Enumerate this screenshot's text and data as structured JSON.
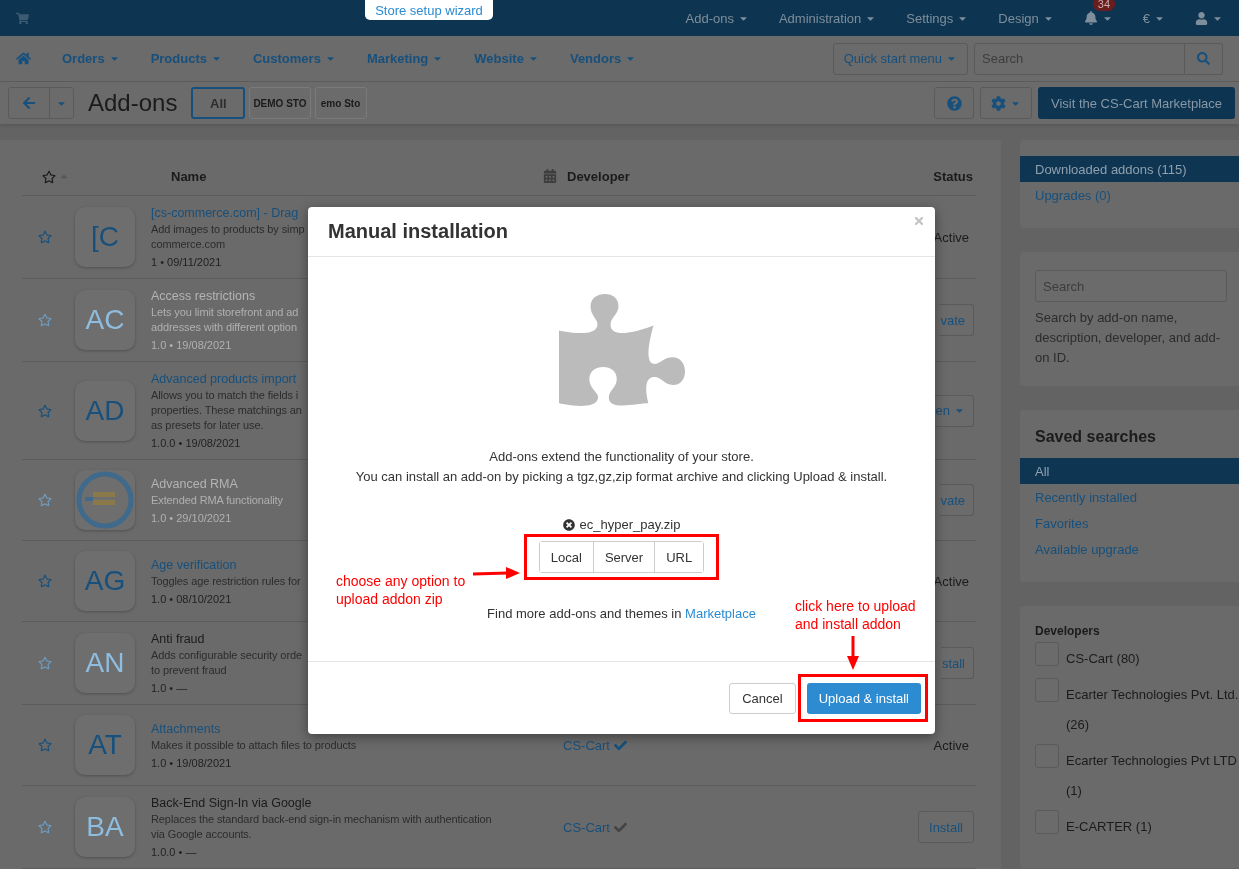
{
  "top_bar": {
    "wizard_tab": "Store setup wizard",
    "menus": [
      "Add-ons",
      "Administration",
      "Settings",
      "Design"
    ],
    "notifications": {
      "count": "34"
    },
    "currency": "€"
  },
  "nav_bar": {
    "menus": [
      "Orders",
      "Products",
      "Customers",
      "Marketing",
      "Website",
      "Vendors"
    ],
    "quick_start": "Quick start menu",
    "search": {
      "placeholder": "Search"
    }
  },
  "toolbar": {
    "title": "Add-ons",
    "storefront_tabs": [
      {
        "label": "All",
        "selected": true,
        "kind": "text"
      },
      {
        "label": "DEMO STO",
        "selected": false,
        "kind": "logo"
      },
      {
        "label": "emo Sto",
        "selected": false,
        "kind": "logo"
      }
    ],
    "marketplace_button": "Visit the CS-Cart Marketplace"
  },
  "table": {
    "columns": [
      "Name",
      "Developer",
      "Status"
    ],
    "rows": [
      {
        "kind": "active",
        "icon": {
          "kind": "letters",
          "text": "[C"
        },
        "title": "[cs-commerce.com] - Drag",
        "description": [
          "Add images to products by simp",
          "commerce.com"
        ],
        "meta": "1 • 09/11/2021",
        "status": {
          "kind": "text",
          "text": "Active"
        }
      },
      {
        "kind": "disabled",
        "icon": {
          "kind": "letters",
          "text": "AC"
        },
        "title": "Access restrictions",
        "description": [
          "Lets you limit storefront and ad",
          "addresses with different option"
        ],
        "meta": "1.0 • 19/08/2021",
        "status": {
          "kind": "button",
          "text": "vate"
        }
      },
      {
        "kind": "active",
        "icon": {
          "kind": "letters",
          "text": "AD"
        },
        "title": "Advanced products import",
        "description": [
          "Allows you to match the fields i",
          "properties. These matchings an",
          "as presets for later use."
        ],
        "meta": "1.0.0 • 19/08/2021",
        "status": {
          "kind": "dropdown",
          "text": "en"
        }
      },
      {
        "kind": "disabled",
        "icon": {
          "kind": "logo"
        },
        "title": "Advanced RMA",
        "description": [
          "Extended RMA functionality"
        ],
        "meta": "1.0 • 29/10/2021",
        "status": {
          "kind": "button",
          "text": "vate"
        }
      },
      {
        "kind": "active",
        "icon": {
          "kind": "letters",
          "text": "AG"
        },
        "title": "Age verification",
        "description": [
          "Toggles age restriction rules for"
        ],
        "meta": "1.0 • 08/10/2021",
        "status": {
          "kind": "text",
          "text": "Active"
        }
      },
      {
        "kind": "not_installed",
        "icon": {
          "kind": "letters",
          "text": "AN"
        },
        "title": "Anti fraud",
        "description": [
          "Adds configurable security orde",
          "to prevent fraud"
        ],
        "meta": "1.0 • —",
        "status": {
          "kind": "button",
          "text": "stall"
        }
      },
      {
        "kind": "active",
        "icon": {
          "kind": "letters",
          "text": "AT"
        },
        "title": "Attachments",
        "description": [
          "Makes it possible to attach files to products"
        ],
        "meta": "1.0 • 19/08/2021",
        "developer": {
          "name": "CS-Cart",
          "verified": true
        },
        "status": {
          "kind": "text",
          "text": "Active"
        }
      },
      {
        "kind": "not_installed",
        "icon": {
          "kind": "letters",
          "text": "BA"
        },
        "title": "Back-End Sign-In via Google",
        "description": [
          "Replaces the standard back-end sign-in mechanism with authentication",
          "via Google accounts."
        ],
        "meta": "1.0.0 • —",
        "developer": {
          "name": "CS-Cart",
          "verified": false
        },
        "status": {
          "kind": "full_button",
          "text": "Install"
        }
      }
    ]
  },
  "sidebar": {
    "views": [
      {
        "label": "Downloaded addons (115)",
        "selected": true
      },
      {
        "label": "Upgrades (0)",
        "selected": false
      }
    ],
    "search": {
      "placeholder": "Search",
      "help": "Search by add-on name, description, developer, and add-on ID."
    },
    "saved_searches": {
      "title": "Saved searches",
      "items": [
        {
          "label": "All",
          "selected": true
        },
        {
          "label": "Recently installed",
          "selected": false
        },
        {
          "label": "Favorites",
          "selected": false
        },
        {
          "label": "Available upgrade",
          "selected": false
        }
      ]
    },
    "developers": {
      "title": "Developers",
      "items": [
        {
          "label": "CS-Cart (80)",
          "checked": false
        },
        {
          "label": "Ecarter Technologies Pvt. Ltd. (26)",
          "checked": false
        },
        {
          "label": "Ecarter Technologies Pvt LTD (1)",
          "checked": false
        },
        {
          "label": "E-CARTER (1)",
          "checked": false
        }
      ]
    }
  },
  "modal": {
    "title": "Manual installation",
    "intro": [
      "Add-ons extend the functionality of your store.",
      "You can install an add-on by picking a tgz,gz,zip format archive and clicking Upload & install."
    ],
    "file": "ec_hyper_pay.zip",
    "sources": [
      "Local",
      "Server",
      "URL"
    ],
    "find_more": "Find more add-ons and themes in",
    "marketplace_link": "Marketplace",
    "cancel": "Cancel",
    "submit": "Upload & install"
  },
  "annotations": [
    {
      "kind": "sources",
      "lines": [
        "choose any option to",
        "upload addon zip"
      ]
    },
    {
      "kind": "submit",
      "lines": [
        "click here to upload",
        "and install addon"
      ]
    }
  ]
}
